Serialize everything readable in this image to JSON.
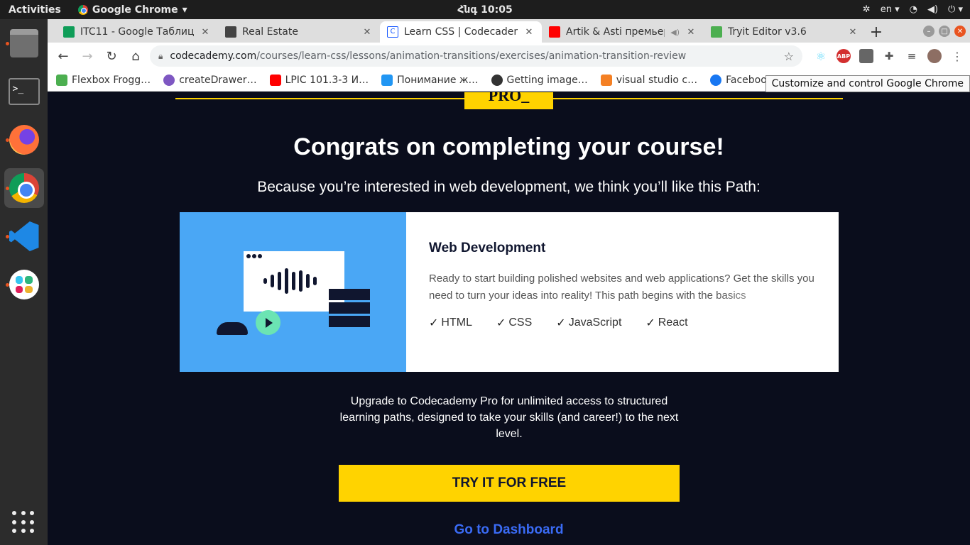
{
  "os": {
    "activities": "Activities",
    "app_name": "Google Chrome",
    "clock": "Հնգ 10:05",
    "lang": "en"
  },
  "tabs": [
    {
      "title": "ITC11 - Google Таблицы",
      "favicon_color": "#0f9d58",
      "active": false
    },
    {
      "title": "Real Estate",
      "favicon_color": "#444444",
      "active": false
    },
    {
      "title": "Learn CSS | Codecademy",
      "favicon_color": "#1557ff",
      "active": true
    },
    {
      "title": "Artik & Asti премьер",
      "favicon_color": "#ff0000",
      "active": false
    },
    {
      "title": "Tryit Editor v3.6",
      "favicon_color": "#4caf50",
      "active": false
    }
  ],
  "omnibox": {
    "host": "codecademy.com",
    "path": "/courses/learn-css/lessons/animation-transitions/exercises/animation-transition-review"
  },
  "bookmarks": [
    {
      "label": "Flexbox Frogg…",
      "color": "#4caf50"
    },
    {
      "label": "createDrawer…",
      "color": "#7e57c2"
    },
    {
      "label": "LPIC 101.3-3 И…",
      "color": "#ff0000"
    },
    {
      "label": "Понимание ж…",
      "color": "#2196f3"
    },
    {
      "label": "Getting image…",
      "color": "#333333"
    },
    {
      "label": "visual studio c…",
      "color": "#f48024"
    },
    {
      "label": "Faceboo",
      "color": "#1877f2"
    }
  ],
  "tooltip": "Customize and control Google Chrome",
  "page": {
    "pro_badge": "PRO_",
    "heading": "Congrats on completing your course!",
    "subheading": "Because you’re interested in web development, we think you’ll like this Path:",
    "card": {
      "title": "Web Development",
      "description": "Ready to start building polished websites and web applications? Get the skills you need to turn your ideas into reality! This path begins with the basics",
      "tags": [
        "HTML",
        "CSS",
        "JavaScript",
        "React"
      ]
    },
    "upgrade_text": "Upgrade to Codecademy Pro for unlimited access to structured learning paths, designed to take your skills (and career!) to the next level.",
    "cta_label": "TRY IT FOR FREE",
    "dashboard_link": "Go to Dashboard"
  },
  "colors": {
    "page_bg": "#0a0d1c",
    "accent_yellow": "#ffd300",
    "link_blue": "#3a6bf5",
    "illus_blue": "#4aa7f5"
  }
}
